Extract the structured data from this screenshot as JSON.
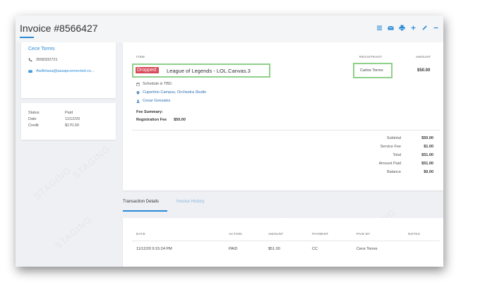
{
  "header": {
    "title": "Invoice #8566427",
    "toolbar_icons": [
      "list-icon",
      "envelope-icon",
      "printer-icon",
      "plus-icon",
      "pencil-icon",
      "minus-icon"
    ]
  },
  "customer": {
    "name": "Cece Torres",
    "phone": "3558332721",
    "email": "Awilletasa@aasapconnected.co..."
  },
  "status": {
    "rows": [
      {
        "label": "Status",
        "value": "Paid"
      },
      {
        "label": "Date",
        "value": "11/12/20"
      },
      {
        "label": "Credit",
        "value": "$170.00"
      }
    ]
  },
  "invoice": {
    "headers": {
      "item": "ITEM",
      "registrant": "REGISTRANT",
      "amount": "AMOUNT"
    },
    "item": {
      "badge": "Dropped:",
      "name": "League of Legends - LOL.Canvas.3",
      "registrant": "Carlos Torres",
      "amount": "$50.00",
      "schedule": "Schedule is TBD.",
      "location": "Cupertino Campus, Orchestra Studio",
      "instructor": "Cesar Gonzalez"
    },
    "fee_summary_title": "Fee Summary:",
    "fee": {
      "label": "Registration Fee",
      "value": "$50.00"
    },
    "totals": [
      {
        "label": "Subtotal",
        "value": "$50.00"
      },
      {
        "label": "Service Fee",
        "value": "$1.00"
      },
      {
        "label": "Total",
        "value": "$51.00"
      },
      {
        "label": "Amount Paid",
        "value": "$51.00"
      },
      {
        "label": "Balance",
        "value": "$0.00"
      }
    ]
  },
  "tabs": [
    {
      "label": "Transaction Details",
      "active": true
    },
    {
      "label": "Invoice History",
      "active": false
    }
  ],
  "transactions": {
    "headers": {
      "date": "DATE",
      "action": "ACTION",
      "amount": "AMOUNT",
      "payment": "PAYMENT",
      "paid_by": "PAID BY",
      "notes": "NOTES"
    },
    "rows": [
      {
        "date": "11/12/20 9:15:24 PM",
        "action": "PAID",
        "amount": "$51.00",
        "payment": "CC",
        "paid_by": "Cece Torres",
        "notes": ""
      }
    ]
  },
  "watermark": "STAGING",
  "colors": {
    "accent": "#2a8ad6",
    "dropped_badge": "#d84a5a",
    "highlight_box": "#8fd08a",
    "background": "#eef0f3"
  }
}
